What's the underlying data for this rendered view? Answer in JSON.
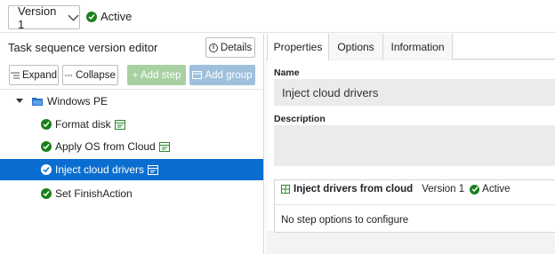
{
  "header": {
    "version_label": "Version 1",
    "status_label": "Active"
  },
  "editor": {
    "title": "Task sequence version editor",
    "details_label": "Details",
    "toolbar": {
      "expand_label": "Expand",
      "collapse_label": "Collapse",
      "add_step_label": "Add step",
      "add_group_label": "Add group"
    },
    "tree": {
      "group_label": "Windows PE",
      "steps": [
        {
          "label": "Format disk",
          "selected": false
        },
        {
          "label": "Apply OS from Cloud",
          "selected": false
        },
        {
          "label": "Inject cloud drivers",
          "selected": true
        },
        {
          "label": "Set FinishAction",
          "selected": false
        }
      ]
    }
  },
  "properties": {
    "tabs": [
      "Properties",
      "Options",
      "Information"
    ],
    "active_tab": "Properties",
    "name_label": "Name",
    "name_value": "Inject cloud drivers",
    "description_label": "Description",
    "description_value": "",
    "step_card": {
      "name": "Inject drivers from cloud",
      "version": "Version 1",
      "status": "Active",
      "options_text": "No step options to configure"
    }
  },
  "colors": {
    "selection": "#0a6ed1",
    "success": "#1b7f1b",
    "add_step_bg": "#a8d0a2",
    "add_group_bg": "#9ec0dc",
    "field_bg": "#ebebeb"
  }
}
